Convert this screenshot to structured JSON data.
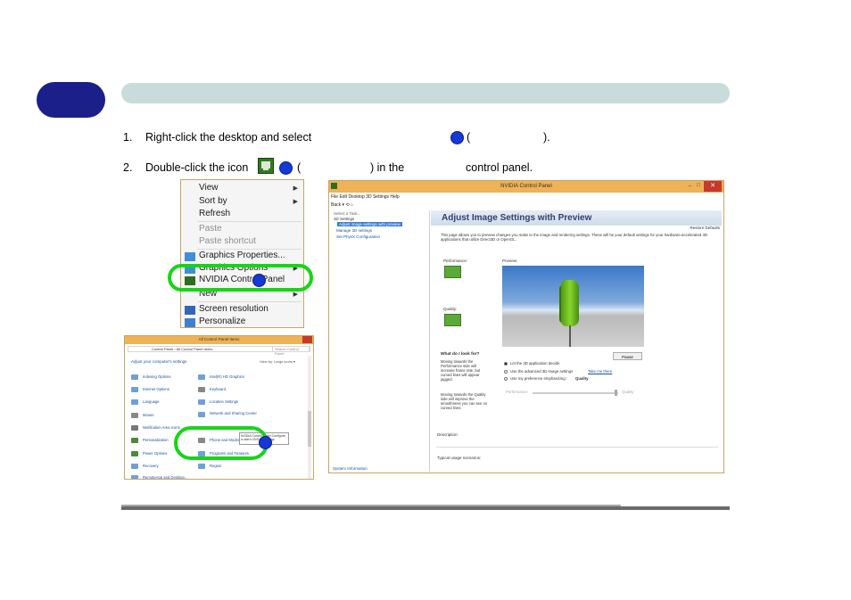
{
  "steps": [
    {
      "number": "1.",
      "text_before": "Right-click the desktop and select",
      "text_mid": "(",
      "text_after": ")."
    },
    {
      "number": "2.",
      "text_before": "Double-click the icon",
      "text_mid": "(",
      "text_after": ") in the",
      "text_end": "control panel."
    }
  ],
  "context_menu": {
    "view": "View",
    "sort_by": "Sort by",
    "refresh": "Refresh",
    "paste": "Paste",
    "paste_shortcut": "Paste shortcut",
    "graphics_properties": "Graphics Properties...",
    "graphics_options": "Graphics Options",
    "nvidia_control_panel": "NVIDIA Control Panel",
    "new": "New",
    "screen_resolution": "Screen resolution",
    "personalize": "Personalize"
  },
  "control_panel": {
    "title": "All Control Panel Items",
    "address": "Control Panel › All Control Panel Items",
    "search_placeholder": "Search Control Panel",
    "heading": "Adjust your computer's settings",
    "view_by": "View by:  Large icons ▾",
    "items_left": [
      "Indexing Options",
      "Internet Options",
      "Language",
      "Mouse",
      "Notification Area Icons",
      "Personalization",
      "Power Options",
      "Recovery",
      "RemoteApp and Desktop..."
    ],
    "items_right": [
      "Intel(R) HD Graphics",
      "Keyboard",
      "Location Settings",
      "Network and Sharing Center",
      "",
      "Phone and Modem",
      "Programs and Features",
      "Region",
      ""
    ],
    "tooltip": "NVIDIA Control Panel  Configure a user's NVIDIA settings"
  },
  "nvidia_panel": {
    "title": "NVIDIA Control Panel",
    "menu": "File  Edit  Desktop  3D Settings  Help",
    "toolbar": "Back  ▾  ⟲  ⌂",
    "select_task": "Select a Task...",
    "category": "3D Settings",
    "tasks": [
      "Adjust image settings with preview",
      "Manage 3D settings",
      "Set PhysX Configuration"
    ],
    "banner_title": "Adjust Image Settings with Preview",
    "restore_defaults": "Restore Defaults",
    "description": "This page allows you to preview changes you make to the image and rendering settings. These will be your default settings for your hardware-accelerated 3D applications that utilize Direct3D or OpenGL.",
    "performance_label": "Performance:",
    "preview_label": "Preview:",
    "quality_label": "Quality:",
    "what_to_look_for": "What do I look for?",
    "para1": "Moving towards the Performance side will increase frame rate, but curved lines will appear jagged.",
    "para2": "Moving towards the Quality side will improve the smoothness you can see on curved lines.",
    "pause": "Pause",
    "options": [
      "Let the 3D application decide",
      "Use the advanced 3D image settings",
      "Use my preference emphasizing:"
    ],
    "take_me_there": "Take me there",
    "emphasis_value": "Quality",
    "slider_left": "Performance",
    "slider_right": "Quality",
    "description_label": "Description:",
    "usage_label": "Typical usage scenarios:",
    "system_information": "System Information"
  }
}
